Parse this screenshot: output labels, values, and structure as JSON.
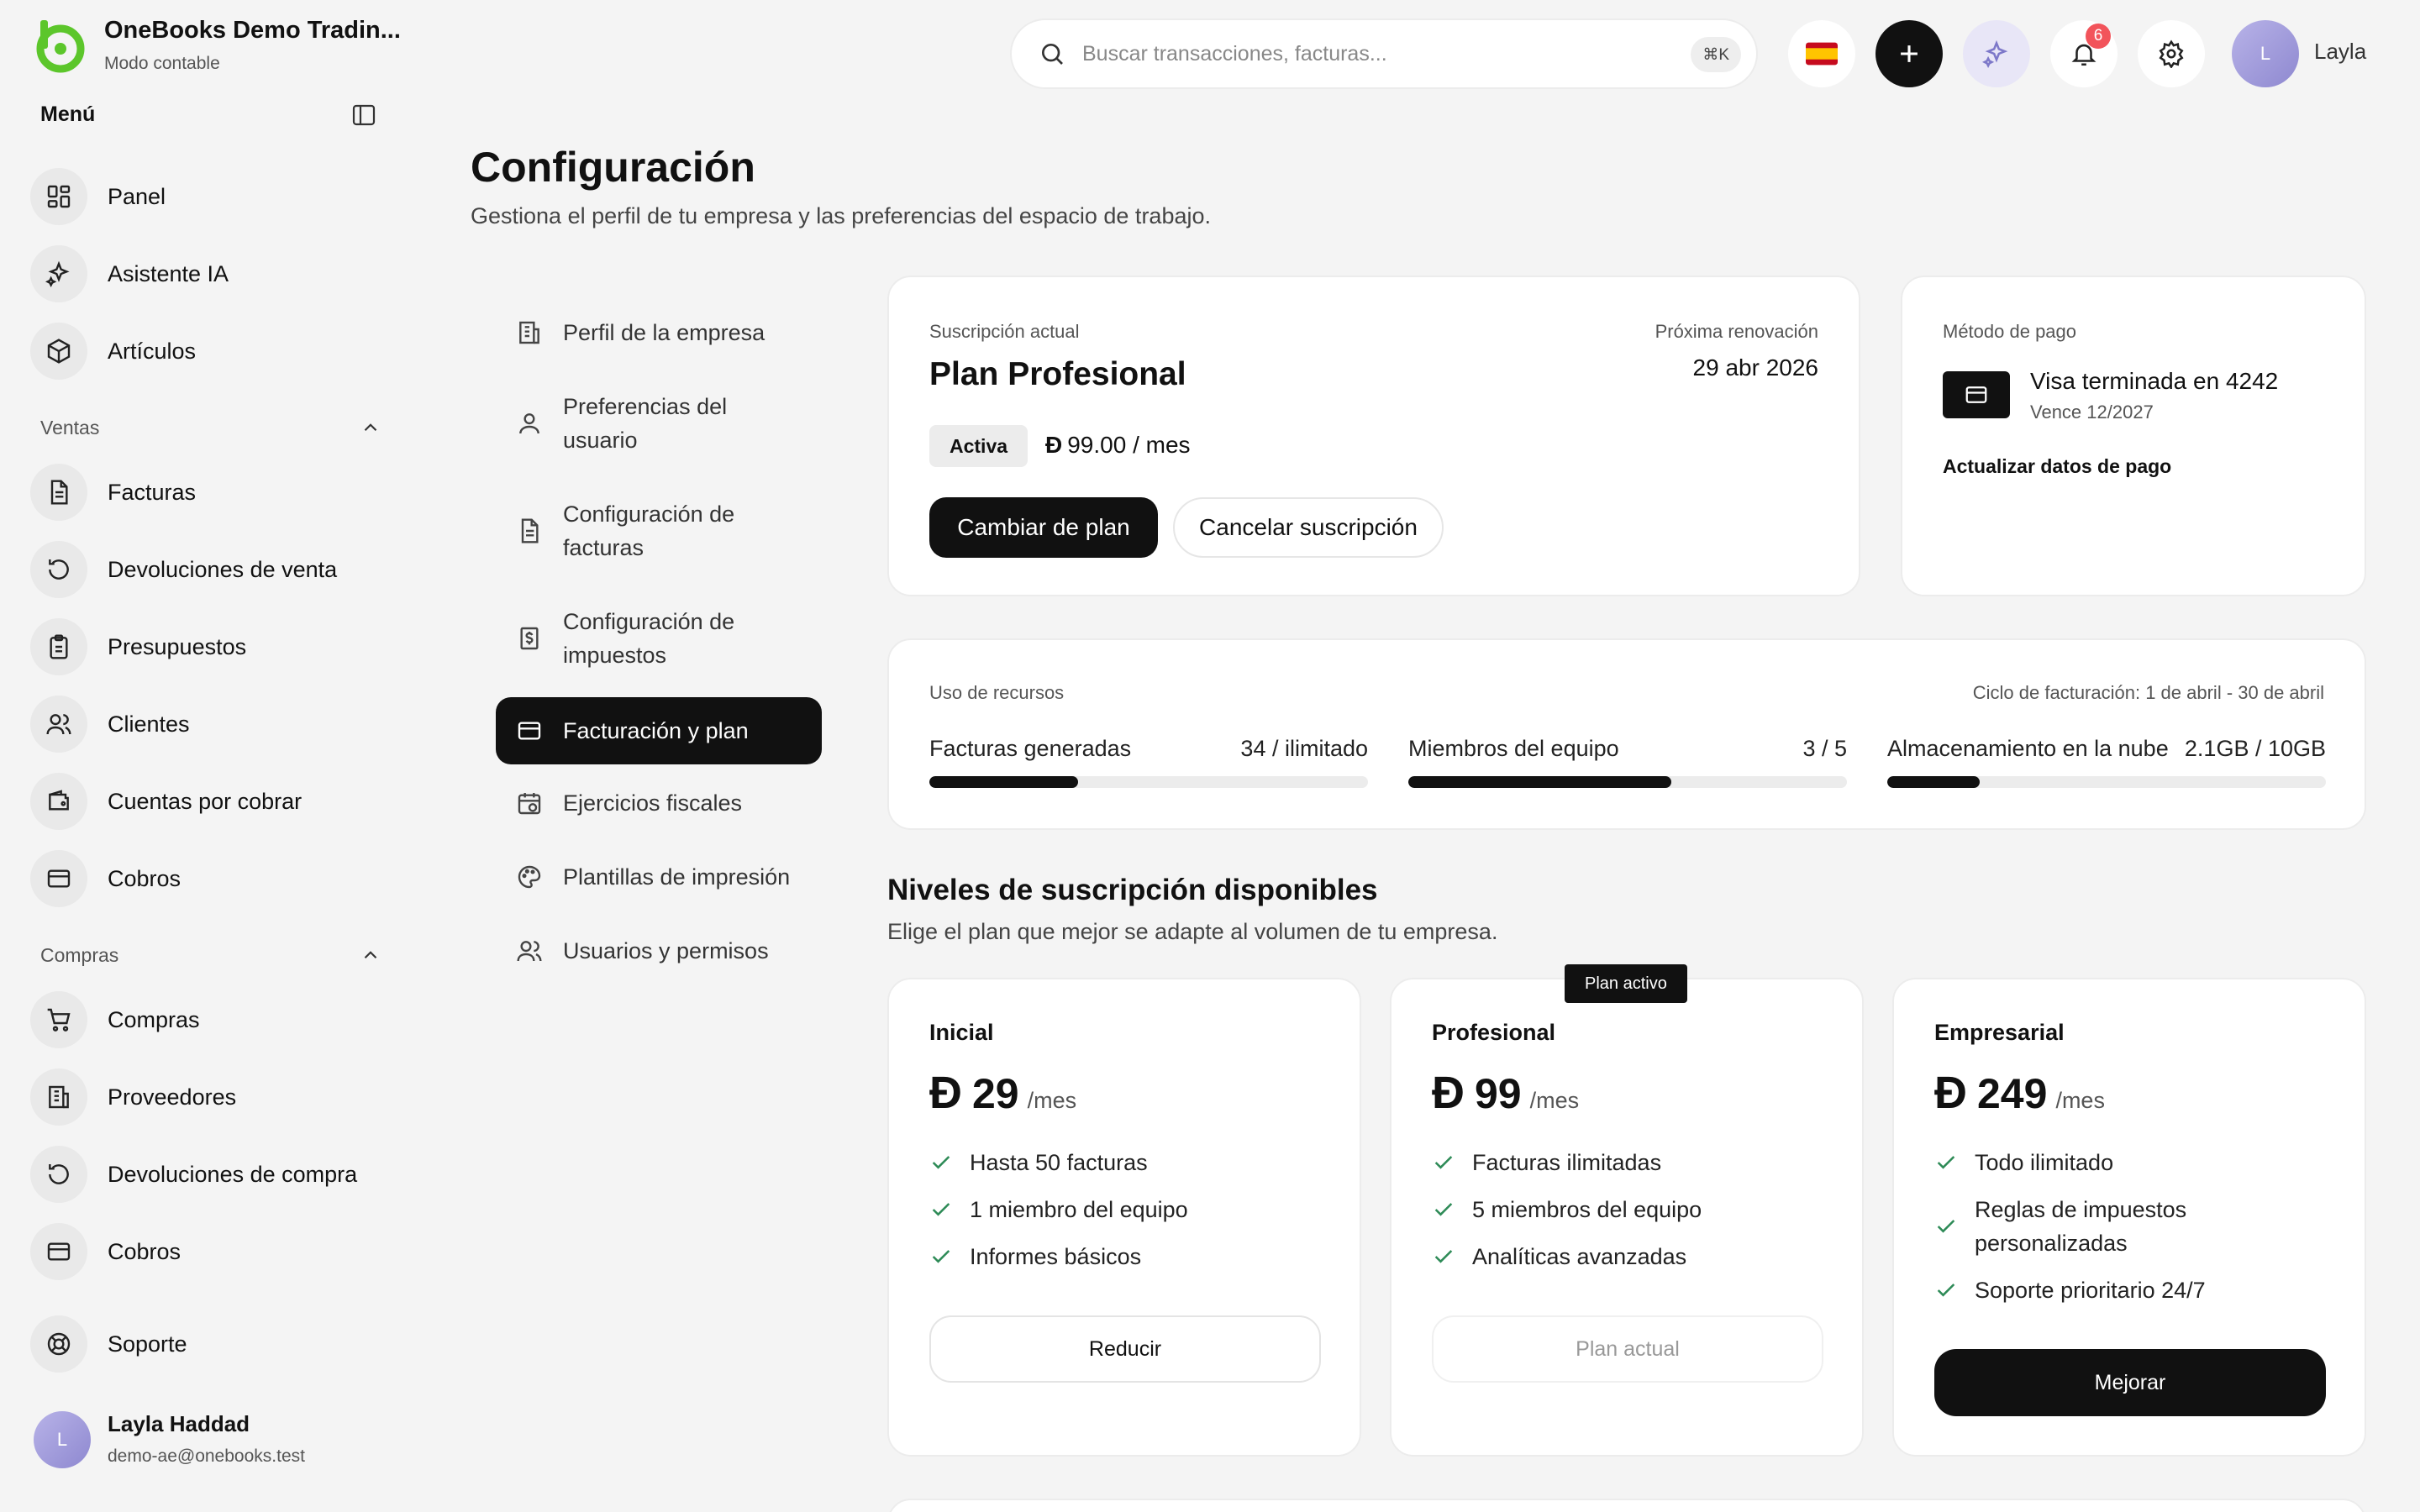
{
  "brand": {
    "title": "OneBooks Demo Tradin...",
    "subtitle": "Modo contable",
    "logo_color": "#5cc62b"
  },
  "sidebar": {
    "menu_title": "Menú",
    "top_items": [
      {
        "label": "Panel",
        "icon": "dashboard-icon"
      },
      {
        "label": "Asistente IA",
        "icon": "sparkles-icon"
      },
      {
        "label": "Artículos",
        "icon": "package-icon"
      }
    ],
    "sales_section": "Ventas",
    "sales_items": [
      {
        "label": "Facturas",
        "icon": "invoice-icon"
      },
      {
        "label": "Devoluciones de venta",
        "icon": "undo-icon"
      },
      {
        "label": "Presupuestos",
        "icon": "clipboard-icon"
      },
      {
        "label": "Clientes",
        "icon": "users-icon"
      },
      {
        "label": "Cuentas por cobrar",
        "icon": "wallet-icon"
      },
      {
        "label": "Cobros",
        "icon": "card-icon"
      }
    ],
    "purchases_section": "Compras",
    "purchases_items": [
      {
        "label": "Compras",
        "icon": "cart-icon"
      },
      {
        "label": "Proveedores",
        "icon": "building-icon"
      },
      {
        "label": "Devoluciones de compra",
        "icon": "undo-icon"
      },
      {
        "label": "Cobros",
        "icon": "card-icon"
      }
    ],
    "support": "Soporte",
    "user": {
      "initial": "L",
      "name": "Layla Haddad",
      "email": "demo-ae@onebooks.test"
    }
  },
  "topbar": {
    "search_placeholder": "Buscar transacciones, facturas...",
    "shortcut": "⌘K",
    "notifications_count": "6",
    "user_initial": "L",
    "user_name": "Layla"
  },
  "page": {
    "title": "Configuración",
    "subtitle": "Gestiona el perfil de tu empresa y las preferencias del espacio de trabajo."
  },
  "settings_nav": [
    {
      "label": "Perfil de la empresa",
      "icon": "building-icon"
    },
    {
      "label": "Preferencias del usuario",
      "icon": "user-icon"
    },
    {
      "label": "Configuración de facturas",
      "icon": "invoice-icon"
    },
    {
      "label": "Configuración de impuestos",
      "icon": "tax-icon"
    },
    {
      "label": "Facturación y plan",
      "icon": "card-icon",
      "active": true
    },
    {
      "label": "Ejercicios fiscales",
      "icon": "calendar-icon"
    },
    {
      "label": "Plantillas de impresión",
      "icon": "palette-icon"
    },
    {
      "label": "Usuarios y permisos",
      "icon": "users-icon"
    }
  ],
  "subscription": {
    "label": "Suscripción actual",
    "plan": "Plan Profesional",
    "status": "Activa",
    "currency": "Đ",
    "price": "99.00 / mes",
    "renewal_label": "Próxima renovación",
    "renewal_date": "29 abr 2026",
    "change_plan": "Cambiar de plan",
    "cancel": "Cancelar suscripción"
  },
  "payment": {
    "label": "Método de pago",
    "card": "Visa terminada en 4242",
    "expiry": "Vence 12/2027",
    "update": "Actualizar datos de pago"
  },
  "usage": {
    "label": "Uso de recursos",
    "cycle": "Ciclo de facturación: 1 de abril - 30 de abril",
    "items": [
      {
        "label": "Facturas generadas",
        "value": "34 / ilimitado",
        "fill": 0.34
      },
      {
        "label": "Miembros del equipo",
        "value": "3 / 5",
        "fill": 0.6
      },
      {
        "label": "Almacenamiento en la nube",
        "value": "2.1GB / 10GB",
        "fill": 0.21
      }
    ]
  },
  "tiers": {
    "title": "Niveles de suscripción disponibles",
    "subtitle": "Elige el plan que mejor se adapte al volumen de tu empresa.",
    "active_badge": "Plan activo",
    "currency": "Đ",
    "per": "/mes",
    "plans": [
      {
        "name": "Inicial",
        "price": "29",
        "features": [
          "Hasta 50 facturas",
          "1 miembro del equipo",
          "Informes básicos"
        ],
        "button": "Reducir"
      },
      {
        "name": "Profesional",
        "price": "99",
        "features": [
          "Facturas ilimitadas",
          "5 miembros del equipo",
          "Analíticas avanzadas"
        ],
        "button": "Plan actual"
      },
      {
        "name": "Empresarial",
        "price": "249",
        "features": [
          "Todo ilimitado",
          "Reglas de impuestos personalizadas",
          "Soporte prioritario 24/7"
        ],
        "button": "Mejorar"
      }
    ]
  }
}
